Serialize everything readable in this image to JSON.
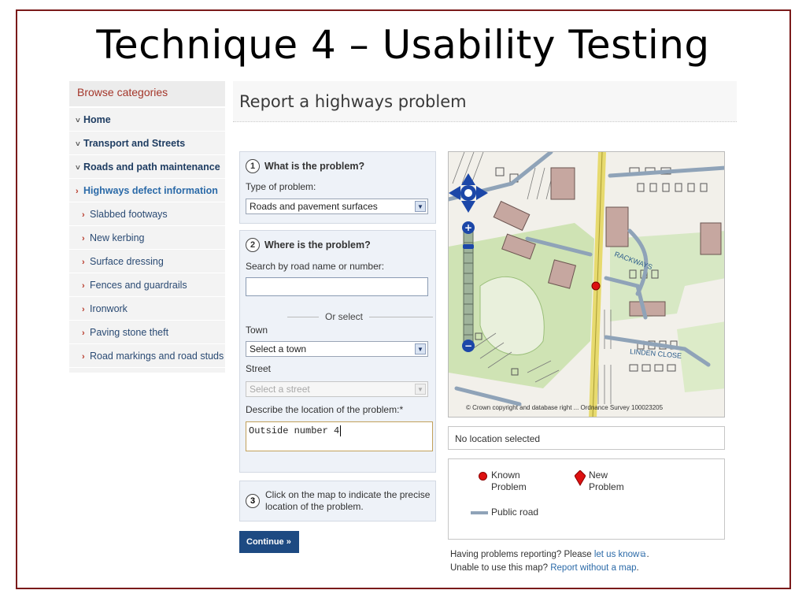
{
  "slide": {
    "title": "Technique 4 – Usability Testing"
  },
  "sidebar": {
    "heading": "Browse categories",
    "items": [
      {
        "marker": "˅",
        "label": "Home"
      },
      {
        "marker": "˅",
        "label": "Transport and Streets"
      },
      {
        "marker": "˅",
        "label": "Roads and path maintenance"
      },
      {
        "marker": "›",
        "label": "Highways defect information"
      },
      {
        "marker": "›",
        "label": "Slabbed footways"
      },
      {
        "marker": "›",
        "label": "New kerbing"
      },
      {
        "marker": "›",
        "label": "Surface dressing"
      },
      {
        "marker": "›",
        "label": "Fences and guardrails"
      },
      {
        "marker": "›",
        "label": "Ironwork"
      },
      {
        "marker": "›",
        "label": "Paving stone theft"
      },
      {
        "marker": "›",
        "label": "Road markings and road studs"
      }
    ]
  },
  "page": {
    "heading": "Report a highways problem"
  },
  "form": {
    "step1": {
      "number": "1",
      "title": "What is the problem?",
      "type_label": "Type of problem:",
      "type_value": "Roads and pavement surfaces"
    },
    "step2": {
      "number": "2",
      "title": "Where is the problem?",
      "search_label": "Search by road name or number:",
      "search_value": "",
      "or_select": "Or select",
      "town_label": "Town",
      "town_value": "Select a town",
      "street_label": "Street",
      "street_value": "Select a street",
      "describe_label": "Describe the location of the problem:*",
      "describe_value": "Outside number 4"
    },
    "step3": {
      "number": "3",
      "text_line1": "Click on the map to indicate the precise",
      "text_line2": "location of the problem."
    },
    "continue_label": "Continue »"
  },
  "map": {
    "copyright": "© Crown copyright and database right ... Ordnance Survey 100023205",
    "status": "No location selected",
    "label_top": "RACKWAYS",
    "label_road": "LINDEN CLOSE"
  },
  "legend": {
    "known_l1": "Known",
    "known_l2": "Problem",
    "new_l1": "New",
    "new_l2": "Problem",
    "road": "Public road",
    "known_color": "#dd1111",
    "new_color": "#dd1111",
    "road_color": "#8fa3b8"
  },
  "help": {
    "line1_prefix": "Having problems reporting? Please ",
    "line1_link": "let us know",
    "line1_suffix": ".",
    "line2_prefix": "Unable to use this map? ",
    "line2_link": "Report without a map",
    "line2_suffix": "."
  }
}
